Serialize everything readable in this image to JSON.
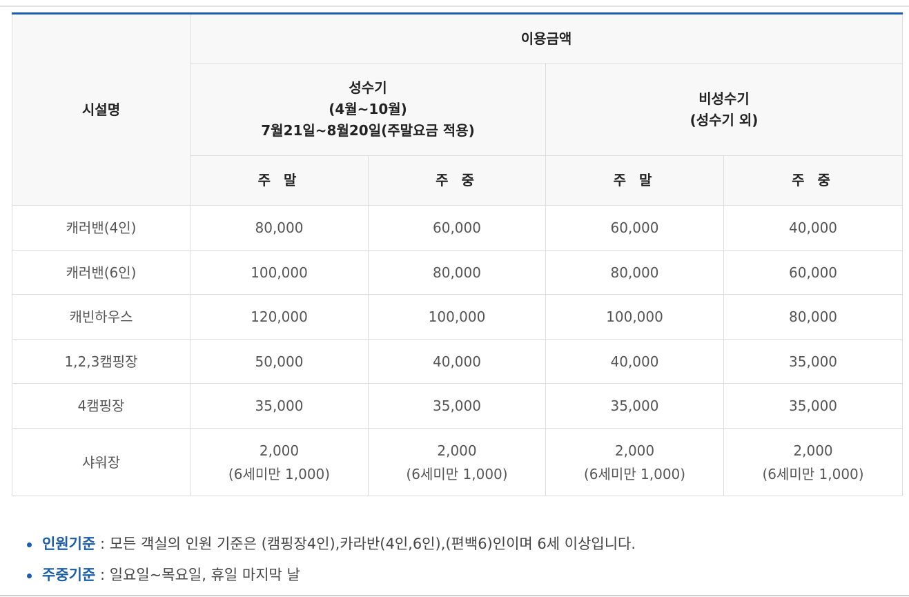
{
  "table": {
    "facility_header": "시설명",
    "price_header": "이용금액",
    "peak": {
      "title": "성수기",
      "months": "(4월~10월)",
      "note": "7월21일~8월20일(주말요금 적용)"
    },
    "offpeak": {
      "title": "비성수기",
      "note": "(성수기 외)"
    },
    "day_headers": [
      "주 말",
      "주 중",
      "주 말",
      "주 중"
    ],
    "rows": [
      {
        "name": "캐러밴(4인)",
        "prices": [
          "80,000",
          "60,000",
          "60,000",
          "40,000"
        ]
      },
      {
        "name": "캐러밴(6인)",
        "prices": [
          "100,000",
          "80,000",
          "80,000",
          "60,000"
        ]
      },
      {
        "name": "캐빈하우스",
        "prices": [
          "120,000",
          "100,000",
          "100,000",
          "80,000"
        ]
      },
      {
        "name": "1,2,3캠핑장",
        "prices": [
          "50,000",
          "40,000",
          "40,000",
          "35,000"
        ]
      },
      {
        "name": "4캠핑장",
        "prices": [
          "35,000",
          "35,000",
          "35,000",
          "35,000"
        ]
      },
      {
        "name": "샤워장",
        "prices": [
          "2,000",
          "2,000",
          "2,000",
          "2,000"
        ],
        "sub": [
          "(6세미만 1,000)",
          "(6세미만 1,000)",
          "(6세미만 1,000)",
          "(6세미만 1,000)"
        ]
      }
    ]
  },
  "notes": [
    {
      "label": "인원기준",
      "text": " : 모든 객실의 인원 기준은 (캠핑장4인),카라반(4인,6인),(편백6)인이며 6세 이상입니다."
    },
    {
      "label": "주중기준",
      "text": " : 일요일~목요일, 휴일 마지막 날"
    }
  ],
  "colors": {
    "accent": "#1a5da8",
    "header_bg": "#f8f8f8",
    "border": "#dddddd"
  }
}
